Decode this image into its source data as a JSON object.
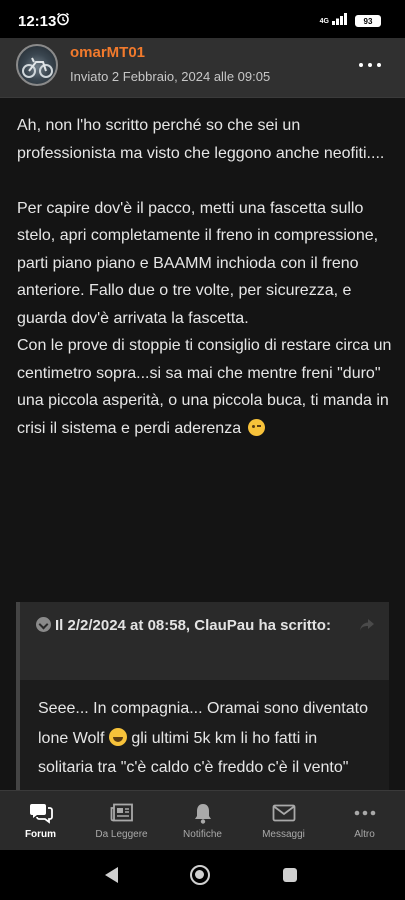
{
  "status_bar": {
    "time": "12:13",
    "network": "4G",
    "battery": "93",
    "icons": [
      "alarm-icon",
      "signal-icon",
      "battery-icon"
    ]
  },
  "post": {
    "author": "omarMT01",
    "date": "Inviato 2 Febbraio, 2024 alle 09:05",
    "paragraphs": [
      "Ah, non l'ho scritto perché so che sei un professionista ma visto che leggono anche neofiti....",
      "Per capire dov'è il pacco, metti una fascetta sullo stelo, apri completamente il freno in compressione, parti piano piano e BAAMM inchioda con il freno anteriore. Fallo due o tre volte, per sicurezza, e guarda dov'è arrivata la fascetta.",
      "Con le prove di stoppie ti consiglio di restare circa un centimetro sopra...si sa mai che mentre freni \"duro\" una piccola asperità, o una piccola buca, ti manda in crisi il sistema e perdi aderenza"
    ]
  },
  "quote": {
    "header": "Il 2/2/2024 at 08:58, ClauPau ha scritto:",
    "body_part1": "Seee... In compagnia... Oramai sono diventato lone Wolf",
    "body_part2": "gli ultimi 5k km li ho fatti in solitaria tra \"c'è caldo c'è freddo c'è il vento\""
  },
  "tabs": [
    {
      "label": "Forum",
      "icon": "forum-icon",
      "active": true
    },
    {
      "label": "Da Leggere",
      "icon": "newspaper-icon",
      "active": false
    },
    {
      "label": "Notifiche",
      "icon": "bell-icon",
      "active": false
    },
    {
      "label": "Messaggi",
      "icon": "envelope-icon",
      "active": false
    },
    {
      "label": "Altro",
      "icon": "more-icon",
      "active": false
    }
  ]
}
